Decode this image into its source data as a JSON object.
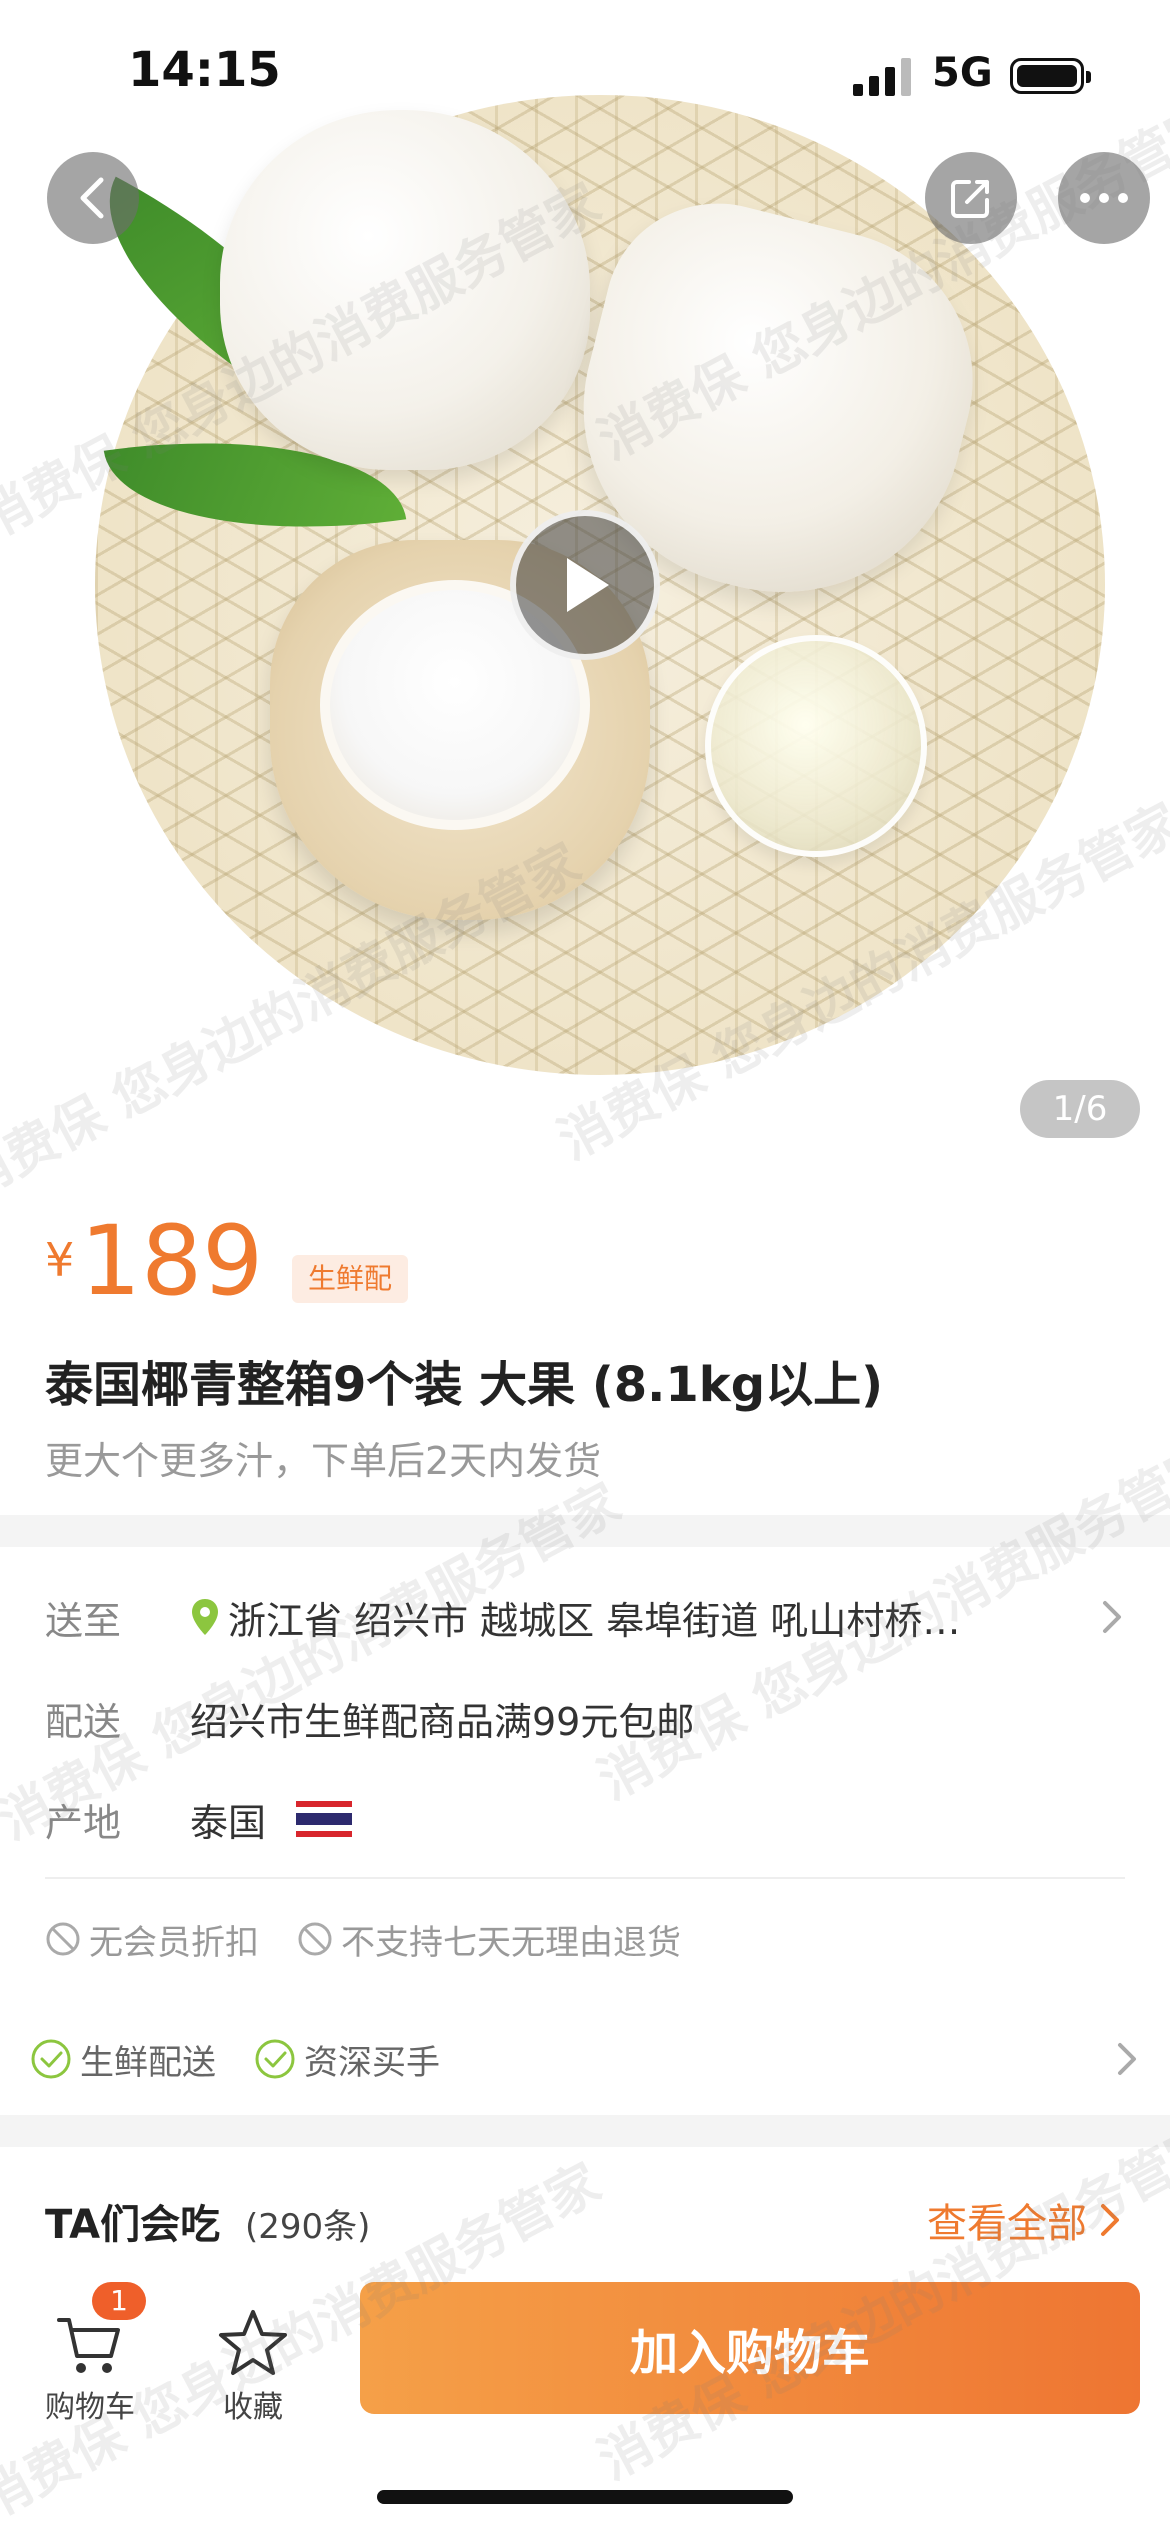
{
  "status_bar": {
    "time": "14:15",
    "network": "5G"
  },
  "gallery": {
    "page_indicator": "1/6"
  },
  "product": {
    "currency_symbol": "¥",
    "price": "189",
    "tag": "生鲜配",
    "title": "泰国椰青整箱9个装 大果 (8.1kg以上)",
    "subtitle": "更大个更多汁，下单后2天内发货"
  },
  "info": {
    "ship_to_label": "送至",
    "ship_to_value": "浙江省 绍兴市 越城区 皋埠街道 吼山村桥…",
    "delivery_label": "配送",
    "delivery_value": "绍兴市生鲜配商品满99元包邮",
    "origin_label": "产地",
    "origin_value": "泰国",
    "restrictions": [
      "无会员折扣",
      "不支持七天无理由退货"
    ],
    "features": [
      "生鲜配送",
      "资深买手"
    ]
  },
  "ta_section": {
    "title": "TA们会吃",
    "count": "(290条)",
    "view_all": "查看全部"
  },
  "bottom_bar": {
    "cart_label": "购物车",
    "cart_badge": "1",
    "favorite_label": "收藏",
    "add_to_cart": "加入购物车"
  },
  "watermark_text": "消费保 您身边的消费服务管家",
  "colors": {
    "accent": "#ef7a2f",
    "green": "#8cc63f",
    "badge": "#ef5f2a"
  },
  "icons": [
    "back-icon",
    "share-icon",
    "more-icon",
    "play-icon",
    "location-pin-icon",
    "chevron-right-icon",
    "forbidden-icon",
    "check-circle-icon",
    "cart-icon",
    "star-icon",
    "thailand-flag-icon"
  ]
}
